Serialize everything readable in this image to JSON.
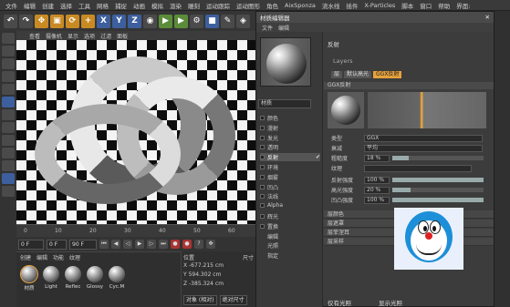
{
  "menubar": [
    "文件",
    "编辑",
    "创建",
    "选择",
    "工具",
    "网格",
    "捕捉",
    "动画",
    "模拟",
    "渲染",
    "雕刻",
    "运动跟踪",
    "运动图形",
    "角色",
    "AixSponza",
    "流水线",
    "插件",
    "X-Particles",
    "脚本",
    "窗口",
    "帮助",
    "界面:"
  ],
  "toolbar": {
    "undo_icon": "undo-icon",
    "x": "X",
    "y": "Y",
    "z": "Z"
  },
  "viewport_menu": [
    "查看",
    "摄像机",
    "显示",
    "选项",
    "过滤",
    "面板"
  ],
  "timeline": {
    "ticks": [
      "0",
      "10",
      "20",
      "30",
      "40",
      "50",
      "60"
    ]
  },
  "playbar": {
    "start_frame": "0 F",
    "current_frame": "0 F",
    "end_frame": "90 F"
  },
  "material_manager": {
    "menu": [
      "创建",
      "编辑",
      "功能",
      "纹理"
    ],
    "materials": [
      "材质",
      "Light",
      "Reflec",
      "Glossy",
      "Cyc.M"
    ]
  },
  "coords": {
    "header_pos": "位置",
    "header_size": "尺寸",
    "x": "X  -677.215 cm",
    "y": "Y  594.302 cm",
    "z": "Z  -385.324 cm",
    "mode": "对象 (相对)",
    "size_mode": "绝对尺寸",
    "apply": "应用"
  },
  "editor": {
    "title": "材质编辑器",
    "menu": [
      "文件",
      "编辑"
    ],
    "material_name": "材质",
    "channels": [
      "颜色",
      "漫射",
      "发光",
      "透明",
      "反射",
      "环境",
      "烟雾",
      "凹凸",
      "法线",
      "Alpha",
      "辉光",
      "置换",
      "编辑",
      "光照",
      "指定"
    ],
    "reflect_header": "反射",
    "layers_label": "Layers",
    "tabs": [
      "层",
      "默认高光",
      "GGX反射"
    ],
    "layer_header": "GGX反射",
    "props": {
      "type_label": "类型",
      "type_value": "GGX",
      "atten_label": "衰减",
      "atten_value": "平均",
      "rough_label": "粗糙度",
      "rough_value": "18 %",
      "tex_label": "纹理",
      "refl_label": "反射强度",
      "refl_value": "100 %",
      "spec_label": "高光强度",
      "spec_value": "20 %",
      "bump_label": "凹凸强度",
      "bump_value": "100 %"
    },
    "folds": [
      "层颜色",
      "层遮罩",
      "层菲涅耳",
      "层采样"
    ],
    "bottom": [
      "仅有光照",
      "显示光照"
    ]
  },
  "progress": {
    "roughness": 0.18,
    "reflection": 1.0,
    "specular": 0.2,
    "bump": 1.0
  }
}
